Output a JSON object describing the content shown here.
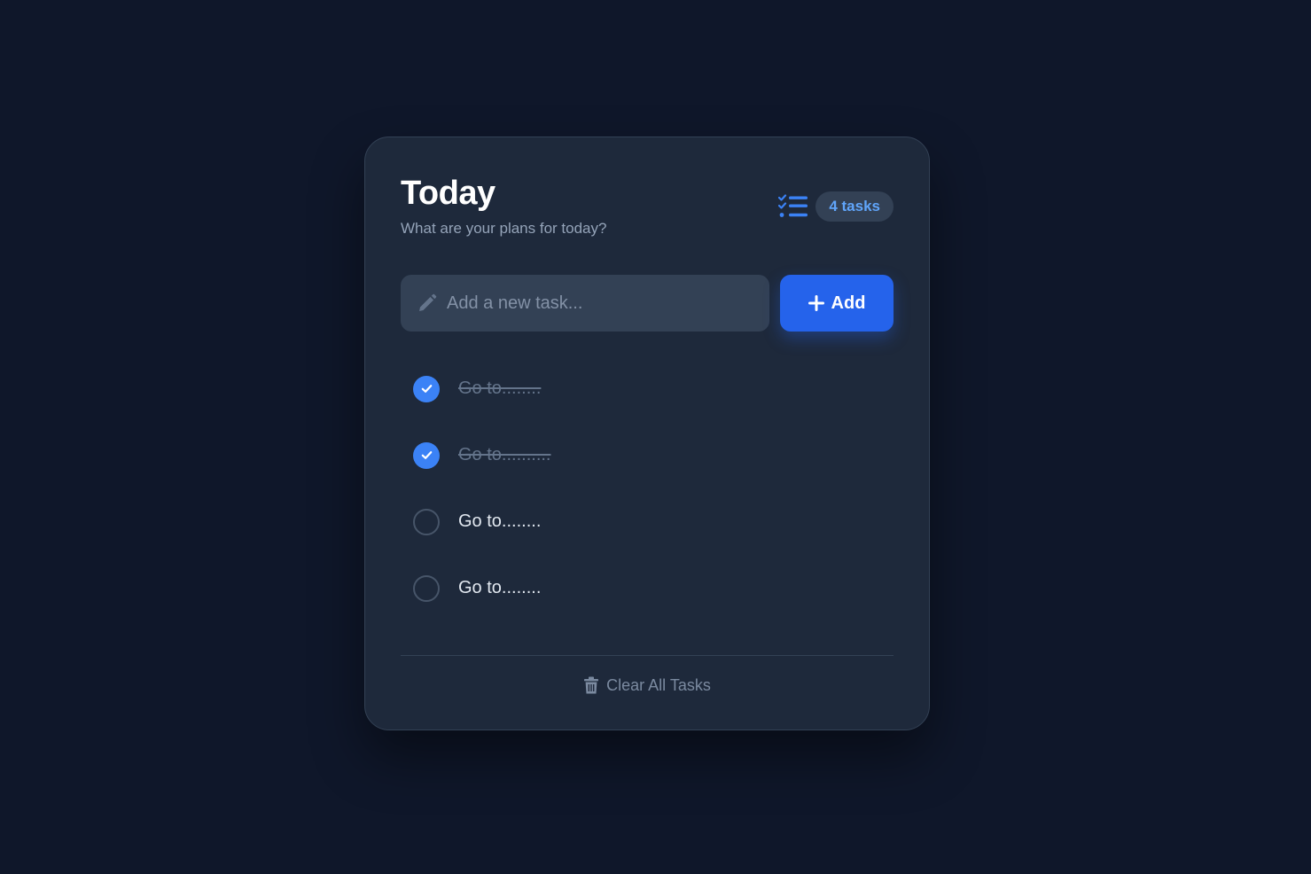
{
  "header": {
    "title": "Today",
    "subtitle": "What are your plans for today?",
    "list_icon": "checklist-icon",
    "task_count": "4 tasks"
  },
  "input": {
    "placeholder": "Add a new task...",
    "value": "",
    "icon": "pencil-icon"
  },
  "add_button": {
    "label": "Add",
    "icon": "plus-icon"
  },
  "tasks": [
    {
      "text": "Go to........",
      "completed": true
    },
    {
      "text": "Go to..........",
      "completed": true
    },
    {
      "text": "Go to........",
      "completed": false
    },
    {
      "text": "Go to........",
      "completed": false
    }
  ],
  "footer": {
    "clear_label": "Clear All Tasks",
    "icon": "trash-icon"
  },
  "colors": {
    "background": "#0f172a",
    "card": "#1e293b",
    "accent": "#3b82f6",
    "button": "#2563eb",
    "input": "#334155"
  }
}
